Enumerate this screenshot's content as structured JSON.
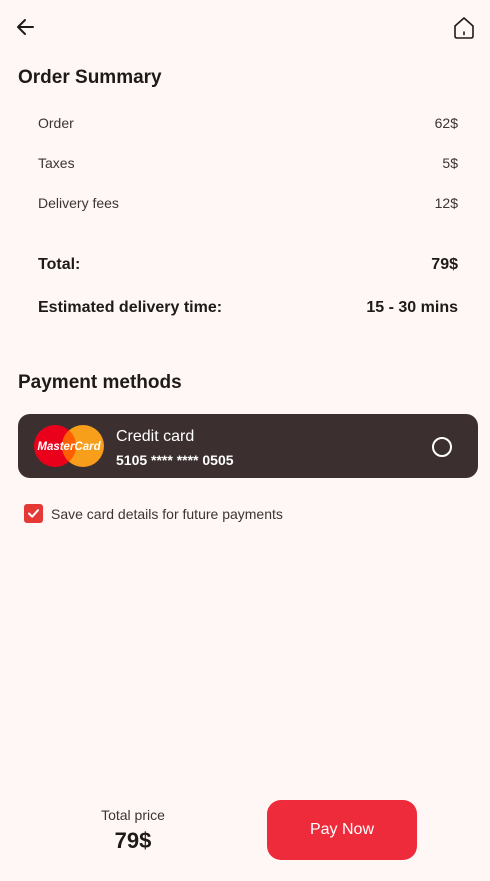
{
  "order_summary": {
    "title": "Order Summary",
    "items": [
      {
        "label": "Order",
        "value": "62$"
      },
      {
        "label": "Taxes",
        "value": "5$"
      },
      {
        "label": "Delivery fees",
        "value": "12$"
      }
    ],
    "total": {
      "label": "Total:",
      "value": "79$"
    },
    "delivery_time": {
      "label": "Estimated delivery time:",
      "value": "15 - 30 mins"
    }
  },
  "payment": {
    "title": "Payment methods",
    "card": {
      "brand_logo_text": "MasterCard",
      "title": "Credit card",
      "number": "5105 **** **** 0505",
      "selected": false
    },
    "save_card": {
      "label": "Save card details for future payments",
      "checked": true
    }
  },
  "footer": {
    "total_label": "Total price",
    "total_value": "79$",
    "pay_button": "Pay Now"
  },
  "colors": {
    "background": "#FFF7F5",
    "card_bg": "#3B302F",
    "accent": "#EE2B3B",
    "checkbox": "#E53935"
  },
  "icons": {
    "back": "arrow-left-icon",
    "home": "home-icon"
  }
}
